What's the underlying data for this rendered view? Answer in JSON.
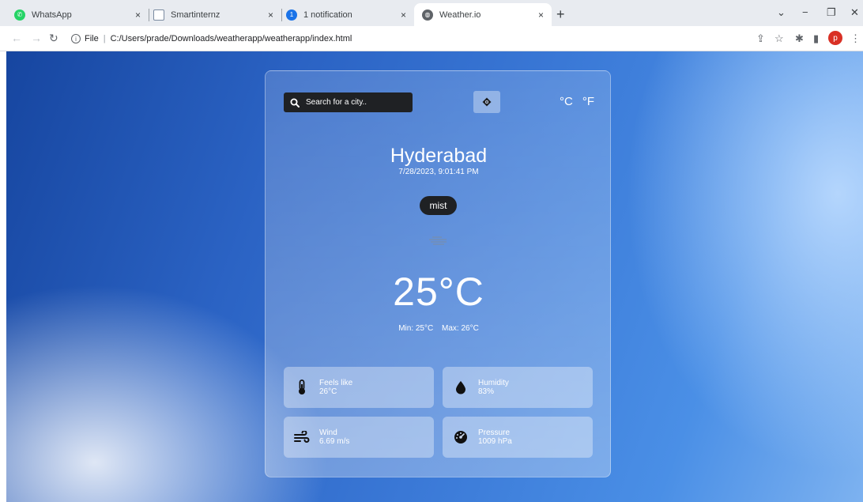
{
  "browser": {
    "tabs": [
      {
        "label": "WhatsApp",
        "favicon": "whatsapp-icon",
        "color": "#25d366"
      },
      {
        "label": "Smartinternz",
        "favicon": "smartinternz-icon",
        "color": "#7a8aa0"
      },
      {
        "label": "1 notification",
        "favicon": "notification-icon",
        "color": "#1a73e8",
        "badge": "1"
      },
      {
        "label": "Weather.io",
        "favicon": "globe-icon",
        "color": "#5f6368"
      }
    ],
    "close_glyph": "×",
    "new_tab_glyph": "+",
    "address": {
      "scheme_label": "File",
      "path": "C:/Users/prade/Downloads/weatherapp/weatherapp/index.html"
    },
    "profile_initial": "p"
  },
  "weather": {
    "search_placeholder": "Search for a city..",
    "unit_celsius": "°C",
    "unit_fahrenheit": "°F",
    "city": "Hyderabad",
    "datetime": "7/28/2023, 9:01:41 PM",
    "description": "mist",
    "temperature": "25°C",
    "min": "Min: 25°C",
    "max": "Max: 26°C",
    "stats": {
      "feels_like": {
        "label": "Feels like",
        "value": "26°C"
      },
      "humidity": {
        "label": "Humidity",
        "value": "83%"
      },
      "wind": {
        "label": "Wind",
        "value": "6.69 m/s"
      },
      "pressure": {
        "label": "Pressure",
        "value": "1009 hPa"
      }
    }
  },
  "colors": {
    "accent": "#2b63c4",
    "card_dark": "#1f2124"
  }
}
